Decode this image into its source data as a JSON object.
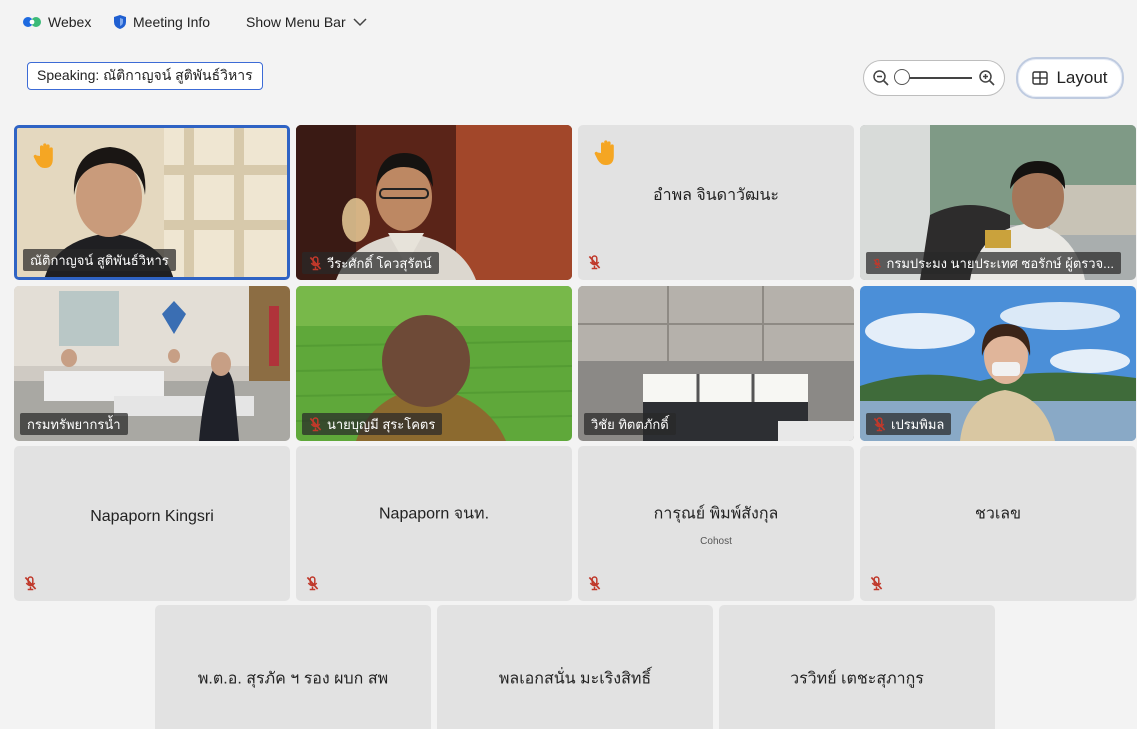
{
  "top": {
    "app_name": "Webex",
    "meeting_info": "Meeting Info",
    "show_menu_bar": "Show Menu Bar"
  },
  "speaking": {
    "label": "Speaking: ณัติกาญจน์ สูติพันธ์วิหาร"
  },
  "layout_button": {
    "label": "Layout"
  },
  "colors": {
    "active_border": "#2f63c4",
    "tile_bg": "#e2e2e2",
    "mute": "#c0392b",
    "hand": "#f5a623"
  },
  "participants": [
    {
      "name": "ณัติกาญจน์ สูติพันธ์วิหาร",
      "hand_raised": true,
      "muted": false,
      "video": true,
      "active_speaker": true
    },
    {
      "name": "วีระศักดิ์ โควสุรัตน์",
      "hand_raised": false,
      "muted": true,
      "video": true
    },
    {
      "name": "อำพล จินดาวัฒนะ",
      "hand_raised": true,
      "muted": true,
      "video": false
    },
    {
      "name": "กรมประมง นายประเทศ ซอรักษ์ ผู้ตรวจ...",
      "hand_raised": false,
      "muted": true,
      "video": true
    },
    {
      "name": "กรมทรัพยากรน้ำ",
      "hand_raised": false,
      "muted": false,
      "video": true
    },
    {
      "name": "นายบุญมี สุระโคตร",
      "hand_raised": false,
      "muted": true,
      "video": true
    },
    {
      "name": "วิชัย ทิตตภักดิ์",
      "hand_raised": false,
      "muted": false,
      "video": true
    },
    {
      "name": "เปรมพิมล",
      "hand_raised": false,
      "muted": true,
      "video": true
    },
    {
      "name": "Napaporn Kingsri",
      "muted": true,
      "video": false
    },
    {
      "name": "Napaporn จนท.",
      "muted": true,
      "video": false
    },
    {
      "name": "การุณย์ พิมพ์สังกุล",
      "role": "Cohost",
      "muted": true,
      "video": false
    },
    {
      "name": "ชวเลข",
      "muted": true,
      "video": false
    },
    {
      "name": "พ.ต.อ. สุรภัค ฯ รอง ผบก สพ",
      "video": false
    },
    {
      "name": "พลเอกสนั่น มะเริงสิทธิ์",
      "video": false
    },
    {
      "name": "วรวิทย์ เตชะสุภากูร",
      "video": false
    }
  ]
}
